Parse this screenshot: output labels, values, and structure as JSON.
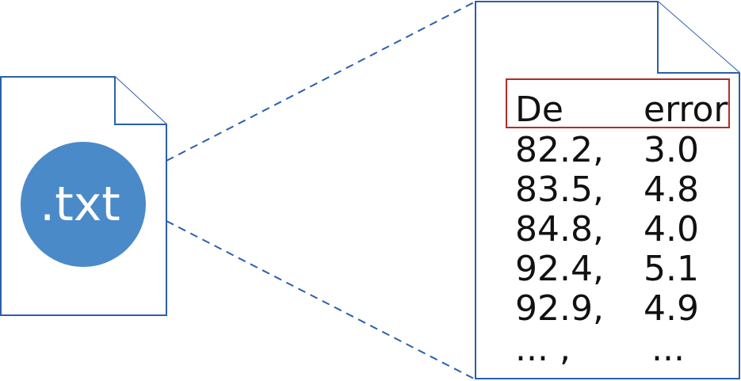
{
  "badge": {
    "label": ".txt",
    "color": "#4a8ac8"
  },
  "table": {
    "headers": [
      "De",
      "error"
    ],
    "rows": [
      [
        "82.2,",
        "3.0"
      ],
      [
        "83.5,",
        "4.8"
      ],
      [
        "84.8,",
        "4.0"
      ],
      [
        "92.4,",
        "5.1"
      ],
      [
        "92.9,",
        "4.9"
      ],
      [
        "... ,",
        "..."
      ]
    ]
  },
  "colors": {
    "outline": "#2a5fae",
    "header_highlight": "#b52a2a"
  }
}
